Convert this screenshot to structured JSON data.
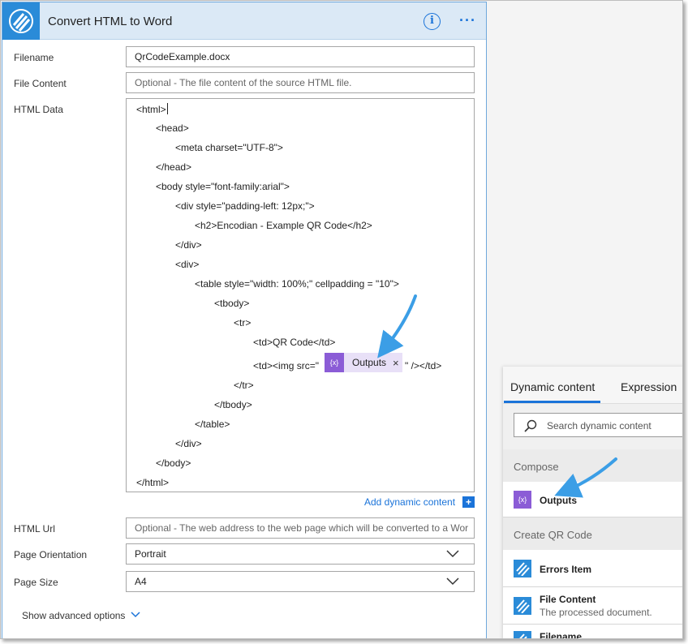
{
  "card": {
    "title": "Convert HTML to Word",
    "info_icon": "info-icon",
    "more_icon": "more-icon",
    "fields": {
      "filename": {
        "label": "Filename",
        "value": "QrCodeExample.docx"
      },
      "file_content": {
        "label": "File Content",
        "placeholder": "Optional - The file content of the source HTML file."
      },
      "html_data": {
        "label": "HTML Data"
      },
      "html_url": {
        "label": "HTML Url",
        "placeholder": "Optional - The web address to the web page which will be converted to a Wor"
      },
      "page_orientation": {
        "label": "Page Orientation",
        "value": "Portrait"
      },
      "page_size": {
        "label": "Page Size",
        "value": "A4"
      }
    },
    "html_lines": [
      "<html>",
      "<head>",
      "<meta charset=\"UTF-8\">",
      "</head>",
      "<body style=\"font-family:arial\">",
      "<div style=\"padding-left: 12px;\">",
      "<h2>Encodian - Example QR Code</h2>",
      "</div>",
      "<div>",
      "<table style=\"width: 100%;\"  cellpadding = \"10\">",
      "<tbody>",
      "<tr>",
      "<td>QR Code</td>",
      "<td><img src=\"",
      "</tr>",
      "</tbody>",
      "</table>",
      "</div>",
      "</body>",
      "</html>"
    ],
    "img_suffix": "\" /></td>",
    "token": {
      "label": "Outputs",
      "close": "×",
      "icon": "compose-icon"
    },
    "add_dynamic_content": "Add dynamic content",
    "show_advanced": "Show advanced options"
  },
  "panel": {
    "tabs": [
      "Dynamic content",
      "Expression"
    ],
    "active_tab": "Dynamic content",
    "search_placeholder": "Search dynamic content",
    "sections": [
      {
        "label": "Compose",
        "items": [
          {
            "label": "Outputs",
            "icon": "compose-icon"
          }
        ]
      },
      {
        "label": "Create QR Code",
        "items": [
          {
            "label": "Errors Item",
            "icon": "encodian-icon"
          },
          {
            "label": "File Content",
            "sub": "The processed document.",
            "icon": "encodian-icon"
          },
          {
            "label": "Filename",
            "icon": "encodian-icon"
          }
        ]
      }
    ]
  },
  "colors": {
    "accent": "#1a73d9",
    "header_bg": "#dbe9f6",
    "compose_purple": "#8b5cd6",
    "encodian_blue": "#2a8bd8",
    "arrow": "#3b9ee6"
  }
}
